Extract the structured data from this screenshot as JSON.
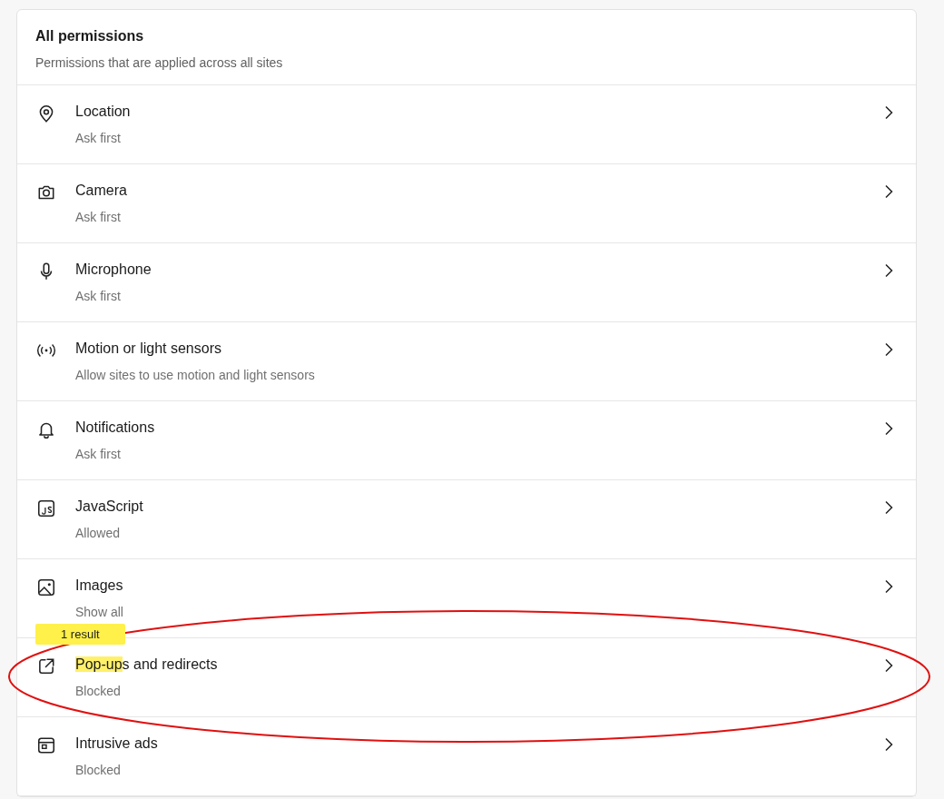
{
  "section": {
    "title": "All permissions",
    "subtitle": "Permissions that are applied across all sites"
  },
  "permissions": [
    {
      "kind": "location",
      "title_parts": [
        {
          "text": "Location",
          "highlighted": false
        }
      ],
      "status": "Ask first"
    },
    {
      "kind": "camera",
      "title_parts": [
        {
          "text": "Camera",
          "highlighted": false
        }
      ],
      "status": "Ask first"
    },
    {
      "kind": "microphone",
      "title_parts": [
        {
          "text": "Microphone",
          "highlighted": false
        }
      ],
      "status": "Ask first"
    },
    {
      "kind": "sensors",
      "title_parts": [
        {
          "text": "Motion or light sensors",
          "highlighted": false
        }
      ],
      "status": "Allow sites to use motion and light sensors"
    },
    {
      "kind": "notifications",
      "title_parts": [
        {
          "text": "Notifications",
          "highlighted": false
        }
      ],
      "status": "Ask first"
    },
    {
      "kind": "javascript",
      "title_parts": [
        {
          "text": "JavaScript",
          "highlighted": false
        }
      ],
      "status": "Allowed"
    },
    {
      "kind": "images",
      "title_parts": [
        {
          "text": "Images",
          "highlighted": false
        }
      ],
      "status": "Show all"
    },
    {
      "kind": "popups",
      "title_parts": [
        {
          "text": "Pop-up",
          "highlighted": true
        },
        {
          "text": "s and redirects",
          "highlighted": false
        }
      ],
      "status": "Blocked",
      "search_tooltip": "1 result",
      "annotated": true
    },
    {
      "kind": "ads",
      "title_parts": [
        {
          "text": "Intrusive ads",
          "highlighted": false
        }
      ],
      "status": "Blocked"
    }
  ]
}
